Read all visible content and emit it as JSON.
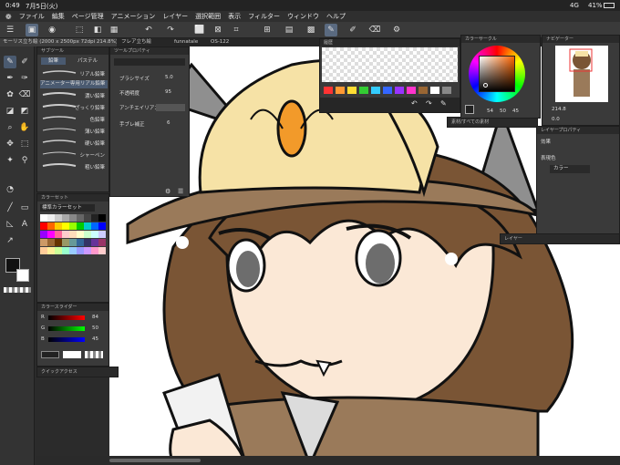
{
  "status": {
    "time": "0:49",
    "date": "7月5日(火)",
    "network": "4G",
    "battery": "41%"
  },
  "menu": [
    "ファイル",
    "編集",
    "ページ管理",
    "アニメーション",
    "レイヤー",
    "選択範囲",
    "表示",
    "フィルター",
    "ウィンドウ",
    "ヘルプ"
  ],
  "tabs": [
    "モーリス立ち絵 (2000 x 2500px 72dpi 214.8%)",
    "フレア立ち絵",
    "funnatale",
    "OS-122"
  ],
  "subtool": {
    "title": "サブツール",
    "tab1": "鉛筆",
    "tab2": "パステル",
    "group": "アニメーター専用リアル鉛筆",
    "items": [
      "リアル鉛筆",
      "濃い鉛筆",
      "ざっくり鉛筆",
      "色鉛筆",
      "薄い鉛筆",
      "硬い鉛筆",
      "シャーペン",
      "粗い鉛筆"
    ]
  },
  "toolprop": {
    "title": "ツールプロパティ",
    "brush_size_label": "ブラシサイズ",
    "brush_size": "5.0",
    "opacity_label": "不透明度",
    "opacity": "95",
    "antialias_label": "アンチエイリアス",
    "stabilize_label": "手ブレ補正",
    "stabilize": "6"
  },
  "colorset": {
    "title": "カラーセット",
    "name": "標準カラーセット"
  },
  "colorslider": {
    "title": "カラースライダー",
    "r_label": "R",
    "r": "84",
    "g_label": "G",
    "g": "50",
    "b_label": "B",
    "b": "45"
  },
  "quick": {
    "title": "クイックアクセス"
  },
  "history": {
    "title": "履歴"
  },
  "wheel": {
    "title": "カラーサークル",
    "v1": "54",
    "v2": "50",
    "v3": "45"
  },
  "navigator": {
    "title": "ナビゲーター",
    "zoom": "214.8",
    "angle": "0.0"
  },
  "layerprop": {
    "title": "レイヤープロパティ",
    "effect_label": "効果",
    "color_label": "表現色",
    "color_value": "カラー"
  },
  "layer": {
    "title": "レイヤー"
  },
  "refpanel": {
    "title": "素材/すべての素材"
  },
  "colors": {
    "accent": "#5a6a80",
    "hair": "#7a5535",
    "hat": "#f6e2a6",
    "panel": "#3a3a3a"
  }
}
